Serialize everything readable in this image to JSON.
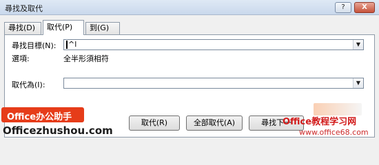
{
  "window": {
    "title": "尋找及取代",
    "help_label": "?",
    "close_label": "X"
  },
  "tabs": [
    {
      "label": "尋找(D)",
      "active": false
    },
    {
      "label": "取代(P)",
      "active": true
    },
    {
      "label": "到(G)",
      "active": false
    }
  ],
  "find": {
    "label": "尋找目標(N):",
    "value": "^l",
    "options_label": "選項:",
    "options_value": "全半形須相符"
  },
  "replace": {
    "label": "取代為(I):",
    "value": ""
  },
  "buttons": {
    "replace": "取代(R)",
    "replace_all": "全部取代(A)",
    "find_next": "尋找下一"
  },
  "watermark": {
    "badge_text": "Office办公助手",
    "url_text": "Officezhushou.com",
    "overlay_text": "Office教程学习网",
    "overlay_url": "www.office68.com"
  },
  "icons": {
    "dropdown": "chevron-down-icon"
  }
}
